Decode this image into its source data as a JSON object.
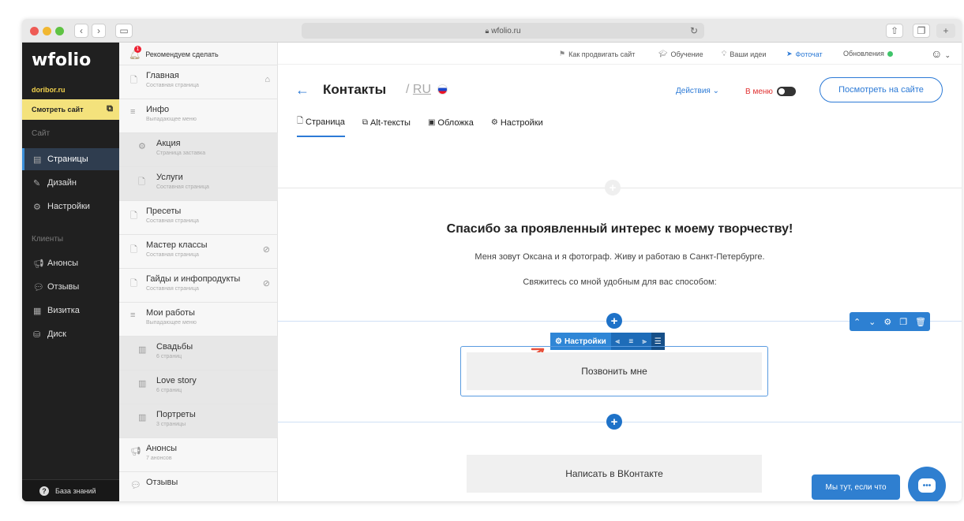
{
  "browser": {
    "url": "wfolio.ru",
    "nav_back": "‹",
    "nav_forward": "›"
  },
  "sidebar": {
    "logo": "wfolio",
    "domain": "doribor.ru",
    "view_site": "Смотреть сайт",
    "section_site": "Сайт",
    "section_clients": "Клиенты",
    "items": [
      {
        "label": "Страницы",
        "icon": "page-icon"
      },
      {
        "label": "Дизайн",
        "icon": "brush-icon"
      },
      {
        "label": "Настройки",
        "icon": "gear-icon"
      },
      {
        "label": "Анонсы",
        "icon": "megaphone-icon"
      },
      {
        "label": "Отзывы",
        "icon": "chat-icon"
      },
      {
        "label": "Визитка",
        "icon": "card-icon"
      },
      {
        "label": "Диск",
        "icon": "database-icon"
      }
    ],
    "knowledge": "База знаний"
  },
  "pages": {
    "notify": "Рекомендуем сделать",
    "notify_count": "1",
    "items": [
      {
        "title": "Главная",
        "sub": "Составная страница"
      },
      {
        "title": "Инфо",
        "sub": "Выпадающее меню"
      },
      {
        "title": "Акция",
        "sub": "Страница заставка"
      },
      {
        "title": "Услуги",
        "sub": "Составная страница"
      },
      {
        "title": "Пресеты",
        "sub": "Составная страница"
      },
      {
        "title": "Мастер классы",
        "sub": "Составная страница"
      },
      {
        "title": "Гайды и инфопродукты",
        "sub": "Составная страница"
      },
      {
        "title": "Мои работы",
        "sub": "Выпадающее меню"
      },
      {
        "title": "Свадьбы",
        "sub": "6 страниц"
      },
      {
        "title": "Love story",
        "sub": "6 страниц"
      },
      {
        "title": "Портреты",
        "sub": "3 страницы"
      },
      {
        "title": "Анонсы",
        "sub": "7 анонсов"
      },
      {
        "title": "Отзывы",
        "sub": ""
      }
    ]
  },
  "topbar": {
    "promote": "Как продвигать сайт",
    "learning": "Обучение",
    "ideas": "Ваши идеи",
    "photochat": "Фоточат",
    "updates": "Обновления"
  },
  "header": {
    "title": "Контакты",
    "lang": "RU",
    "lang_sep": "/",
    "actions": "Действия",
    "in_menu": "В меню",
    "view_button": "Посмотреть на сайте"
  },
  "tabs": [
    {
      "label": "Страница"
    },
    {
      "label": "Alt-тексты"
    },
    {
      "label": "Обложка"
    },
    {
      "label": "Настройки"
    }
  ],
  "content": {
    "heading": "Спасибо за проявленный интерес к моему творчеству!",
    "intro": "Меня зовут Оксана и я фотограф. Живу и работаю в Санкт-Петербурге.",
    "contact_line": "Свяжитесь со мной удобным для вас способом:",
    "button1": "Позвонить мне",
    "button2": "Написать в ВКонтакте",
    "block_settings": "Настройки"
  },
  "chat": {
    "label": "Мы тут, если что",
    "bubble_icon": "•••"
  },
  "colors": {
    "accent": "#2c7ad6",
    "sidebar_bg": "#202020",
    "view_site_bg": "#f4e27c"
  }
}
